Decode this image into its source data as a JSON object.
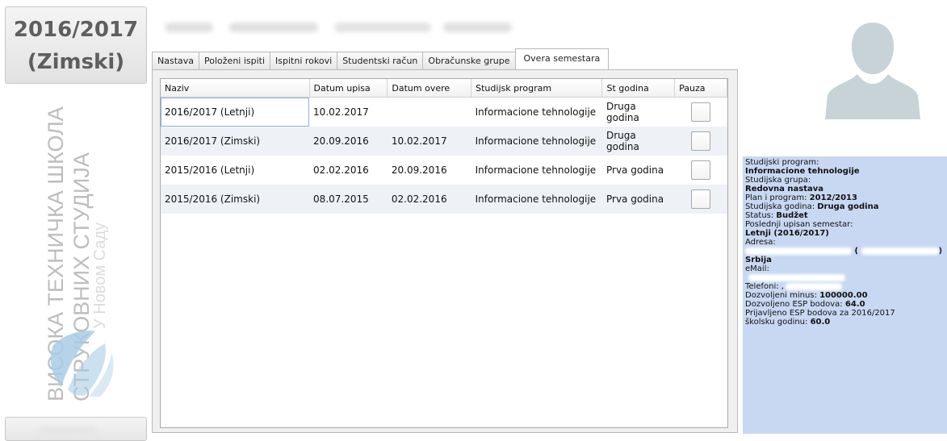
{
  "semester": {
    "year": "2016/2017",
    "term": "(Zimski)"
  },
  "school": {
    "line1": "ВИСОКА ТЕХНИЧКА ШКОЛА",
    "line2": "СТРУКОВНИХ СТУДИЈА",
    "line3": "У Новом Саду"
  },
  "tabs": [
    {
      "label": "Nastava"
    },
    {
      "label": "Položeni ispiti"
    },
    {
      "label": "Ispitni rokovi"
    },
    {
      "label": "Studentski račun"
    },
    {
      "label": "Obračunske grupe"
    },
    {
      "label": "Overa semestara"
    }
  ],
  "table": {
    "headers": [
      "Naziv",
      "Datum upisa",
      "Datum overe",
      "Studijsk program",
      "St godina",
      "Pauza"
    ],
    "rows": [
      {
        "naziv": "2016/2017 (Letnji)",
        "upis": "10.02.2017",
        "overa": "",
        "program": "Informacione tehnologije",
        "godina": "Druga godina"
      },
      {
        "naziv": "2016/2017 (Zimski)",
        "upis": "20.09.2016",
        "overa": "10.02.2017",
        "program": "Informacione tehnologije",
        "godina": "Druga godina"
      },
      {
        "naziv": "2015/2016 (Letnji)",
        "upis": "02.02.2016",
        "overa": "20.09.2016",
        "program": "Informacione tehnologije",
        "godina": "Prva godina"
      },
      {
        "naziv": "2015/2016 (Zimski)",
        "upis": "08.07.2015",
        "overa": "02.02.2016",
        "program": "Informacione tehnologije",
        "godina": "Prva godina"
      }
    ]
  },
  "info": {
    "program_label": "Studijski program:",
    "program_value": "Informacione tehnologije",
    "grupa_label": "Studijska grupa:",
    "grupa_value": "Redovna nastava",
    "plan_label": "Plan i program: ",
    "plan_value": "2012/2013",
    "godina_label": "Studijska godina: ",
    "godina_value": "Druga godina",
    "status_label": "Status: ",
    "status_value": "Budžet",
    "poslednji_label": "Poslednji upisan semestar:",
    "poslednji_value": "Letnji (2016/2017)",
    "adresa_label": "Adresa:",
    "adresa_end": ")",
    "drzava_value": "Srbija",
    "email_label": "eMail:",
    "telefon_label": "Telefoni: ,",
    "minus_label": "Dozvoljeni minus: ",
    "minus_value": "100000.00",
    "esp_label": "Dozvoljeno ESP bodova: ",
    "esp_value": "64.0",
    "prijavljeno_label": "Prijavljeno ESP bodova za  2016/2017",
    "skolska_label": "školsku godinu: ",
    "skolska_value": "60.0"
  },
  "colors": {
    "info_bg": "#c9d8f2",
    "logo_blue": "#a9cde6",
    "text_gray": "#5e5e5e"
  }
}
